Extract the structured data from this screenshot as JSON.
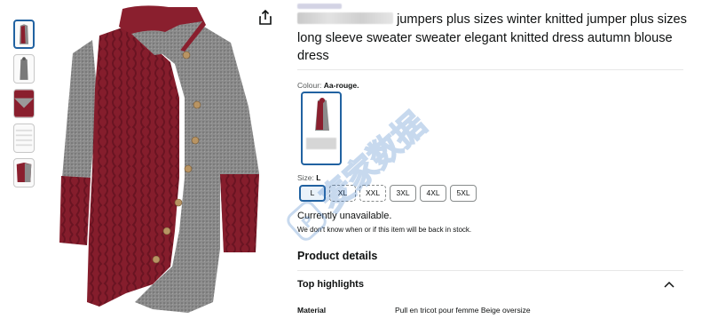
{
  "product": {
    "title_visible": "jumpers plus sizes winter knitted jumper plus sizes long sleeve sweater sweater elegant knitted dress autumn blouse dress"
  },
  "colour": {
    "label": "Colour: ",
    "value": "Aa-rouge."
  },
  "size": {
    "label": "Size: ",
    "value": "L",
    "options": [
      "L",
      "XL",
      "XXL",
      "3XL",
      "4XL",
      "5XL"
    ]
  },
  "availability": {
    "status": "Currently unavailable.",
    "note": "We don't know when or if this item will be back in stock."
  },
  "details": {
    "heading": "Product details",
    "highlights_heading": "Top highlights",
    "material_key": "Material",
    "material_value": "Pull en tricot pour femme Beige oversize"
  },
  "watermark_text": "麦家数据",
  "colors": {
    "accent": "#2162a1",
    "burgundy": "#8a1f2e",
    "grey_knit": "#8a8a8a"
  },
  "icons": [
    "share-icon",
    "chevron-up-icon"
  ]
}
